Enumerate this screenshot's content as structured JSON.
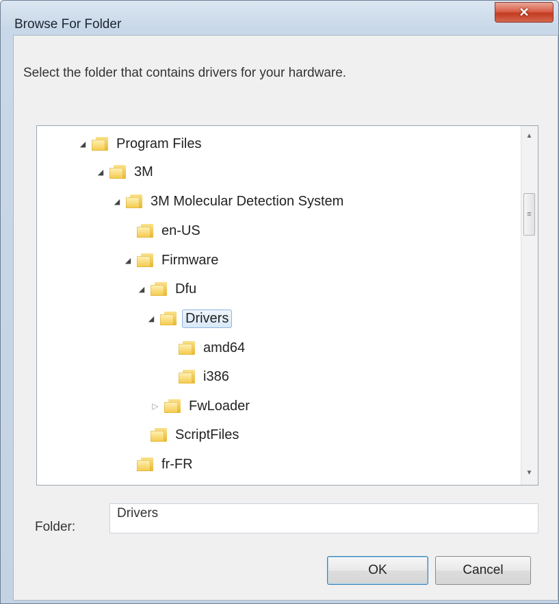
{
  "window": {
    "title": "Browse For Folder",
    "close_glyph": "✕"
  },
  "instruction": "Select the folder that contains drivers for your hardware.",
  "tree": {
    "items": [
      {
        "label": "Program Files",
        "expander": "expanded"
      },
      {
        "label": "3M",
        "expander": "expanded"
      },
      {
        "label": "3M Molecular Detection System",
        "expander": "expanded"
      },
      {
        "label": "en-US",
        "expander": "none"
      },
      {
        "label": "Firmware",
        "expander": "expanded"
      },
      {
        "label": "Dfu",
        "expander": "expanded"
      },
      {
        "label": "Drivers",
        "expander": "expanded",
        "selected": true
      },
      {
        "label": "amd64",
        "expander": "none"
      },
      {
        "label": "i386",
        "expander": "none"
      },
      {
        "label": "FwLoader",
        "expander": "collapsed"
      },
      {
        "label": "ScriptFiles",
        "expander": "none"
      },
      {
        "label": "fr-FR",
        "expander": "none"
      }
    ]
  },
  "folder_field": {
    "label": "Folder:",
    "value": "Drivers"
  },
  "buttons": {
    "ok": "OK",
    "cancel": "Cancel"
  },
  "icons": {
    "folder": "folder-icon",
    "expanded": "expanded-triangle-icon",
    "collapsed": "collapsed-triangle-icon"
  },
  "colors": {
    "selection_fill": "#d8e9f8",
    "selection_border": "#8fb4dc",
    "close_button": "#c23c22",
    "ok_border": "#3c7fb1"
  }
}
